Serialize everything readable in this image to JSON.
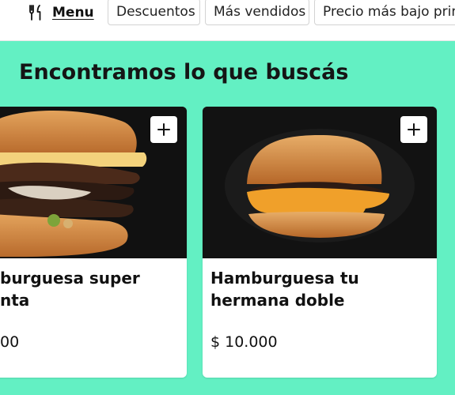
{
  "topbar": {
    "menu_label": "Menu",
    "menu_icon": "fork-knife-icon",
    "chips": [
      "Descuentos",
      "Más vendidos",
      "Precio más bajo prim"
    ]
  },
  "main": {
    "title": "Encontramos lo que buscás",
    "products": [
      {
        "name_lines": [
          "burguesa super",
          "nta"
        ],
        "price": "00",
        "add_icon": "plus-icon"
      },
      {
        "name_lines": [
          "Hamburguesa tu",
          "hermana doble"
        ],
        "price": "$ 10.000",
        "add_icon": "plus-icon"
      }
    ]
  },
  "colors": {
    "accent": "#63F0C3",
    "card": "#FFFFFF",
    "text": "#111111"
  }
}
